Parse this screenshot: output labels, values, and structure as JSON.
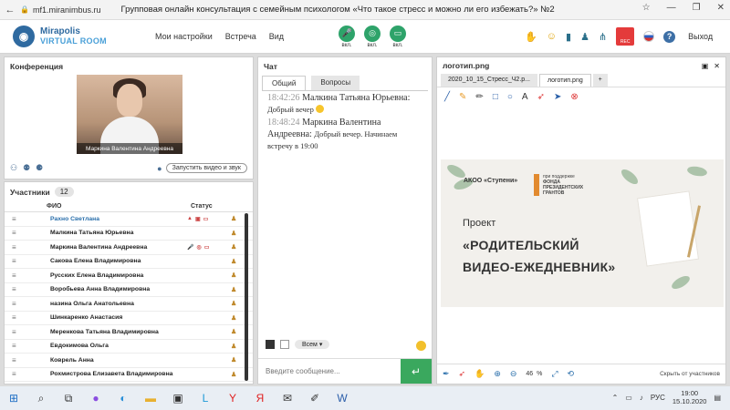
{
  "browser": {
    "url": "mf1.miranimbus.ru",
    "title": "Групповая онлайн консультация с семейным психологом «Что такое стресс и можно ли его избежать?» №2"
  },
  "header": {
    "logo_line1": "Mirapolis",
    "logo_line2": "VIRTUAL ROOM",
    "menu": [
      "Мои настройки",
      "Встреча",
      "Вид"
    ],
    "controls": [
      {
        "label": "вкл.",
        "icon": "microphone-icon"
      },
      {
        "label": "вкл.",
        "icon": "camera-icon"
      },
      {
        "label": "вкл.",
        "icon": "screen-share-icon"
      }
    ],
    "rec_label": "REC",
    "exit_label": "Выход"
  },
  "conference": {
    "title": "Конференция",
    "video_caption": "Маркина Валентина  Андреевна",
    "start_button": "Запустить видео и звук"
  },
  "participants": {
    "title": "Участники",
    "count": "12",
    "col_name": "ФИО",
    "col_status": "Статус",
    "rows": [
      "Рахно Светлана",
      "Малкина Татьяна  Юрьевна",
      "Маркина Валентина  Андреевна",
      "Сакова Елена Владимировна",
      "Русских Елена Владимировна",
      "Воробьева Анна  Владимировна",
      "назина  Ольга Анатольевна",
      "Шинкаренко  Анастасия",
      "Меренкова  Татьяна  Владимировна",
      "Евдокимова Ольга",
      "Коврель Анна",
      "Рохмистрова  Елизавета Владимировна"
    ]
  },
  "chat": {
    "title": "Чат",
    "tabs": [
      "Общий",
      "Вопросы"
    ],
    "messages": [
      {
        "time": "18:42:26",
        "author": "Малкина Татьяна Юрьевна:",
        "text": "Добрый вечер"
      },
      {
        "time": "18:48:24",
        "author": "Маркина Валентина Андреевна:",
        "text": "Добрый вечер. Начинаем встречу в 19:00"
      }
    ],
    "recipient": "Всем",
    "placeholder": "Введите сообщение..."
  },
  "presentation": {
    "title": "логотип.png",
    "tabs": [
      "2020_10_15_Стресс_Ч2.p...",
      "логотип.png",
      "+"
    ],
    "slide": {
      "org": "АКОО «Ступени»",
      "fond": [
        "ФОНДА",
        "ПРЕЗИДЕНТСКИХ",
        "ГРАНТОВ"
      ],
      "fond_top": "при поддержке",
      "line1": "Проект",
      "line2": "«РОДИТЕЛЬСКИЙ",
      "line3": "ВИДЕО-ЕЖЕДНЕВНИК»"
    },
    "zoom": "46",
    "zoom_unit": "%",
    "hide_label": "Скрыть от участников"
  },
  "taskbar": {
    "lang": "РУС",
    "time": "19:00",
    "date": "15.10.2020"
  }
}
